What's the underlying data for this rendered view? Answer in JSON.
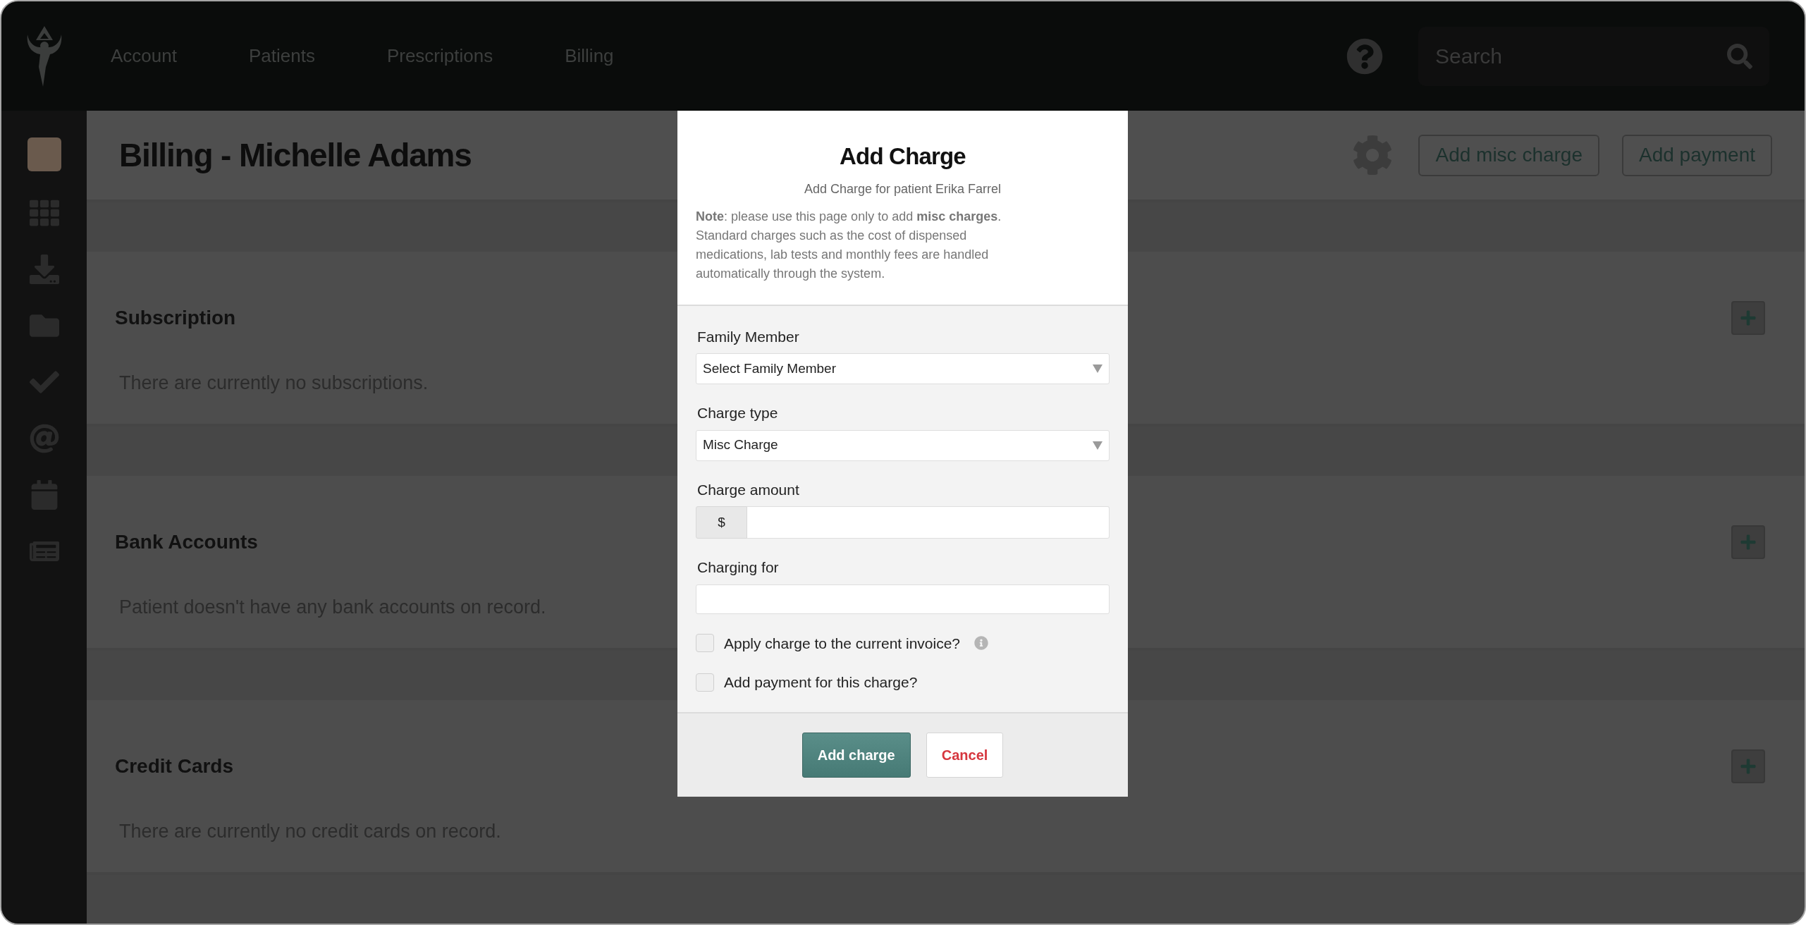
{
  "nav": [
    {
      "label": "Account"
    },
    {
      "label": "Patients"
    },
    {
      "label": "Prescriptions"
    },
    {
      "label": "Billing"
    }
  ],
  "search": {
    "placeholder": "Search"
  },
  "page": {
    "title": "Billing - Michelle Adams",
    "buttons": [
      "Add misc charge",
      "Add payment"
    ]
  },
  "sections": [
    {
      "title": "Subscription",
      "empty_text": "There are currently no subscriptions."
    },
    {
      "title": "Bank Accounts",
      "empty_text": "Patient doesn't have any bank accounts on record."
    },
    {
      "title": "Credit Cards",
      "empty_text": "There are currently no credit cards on record."
    }
  ],
  "modal": {
    "title": "Add Charge",
    "subtitle": "Add Charge for patient Erika Farrel",
    "note": "**Note**: please use this page only to add **misc charges**. Standard charges such as the cost of dispensed medications, lab tests and monthly fees are handled automatically through the system.",
    "fields": [
      {
        "kind": "select",
        "label": "Family Member",
        "value": "Select Family Member"
      },
      {
        "kind": "select",
        "label": "Charge type",
        "value": "Misc Charge"
      },
      {
        "kind": "currency",
        "label": "Charge amount",
        "prefix": "$"
      },
      {
        "kind": "text",
        "label": "Charging for"
      }
    ],
    "checkboxes": [
      {
        "label": "Apply charge to the current invoice?",
        "checked": false,
        "info": true
      },
      {
        "label": "Add payment for this charge?",
        "checked": false,
        "info": false
      }
    ],
    "buttons": [
      {
        "label": "Add charge",
        "kind": "primary"
      },
      {
        "label": "Cancel",
        "kind": "cancel"
      }
    ]
  }
}
